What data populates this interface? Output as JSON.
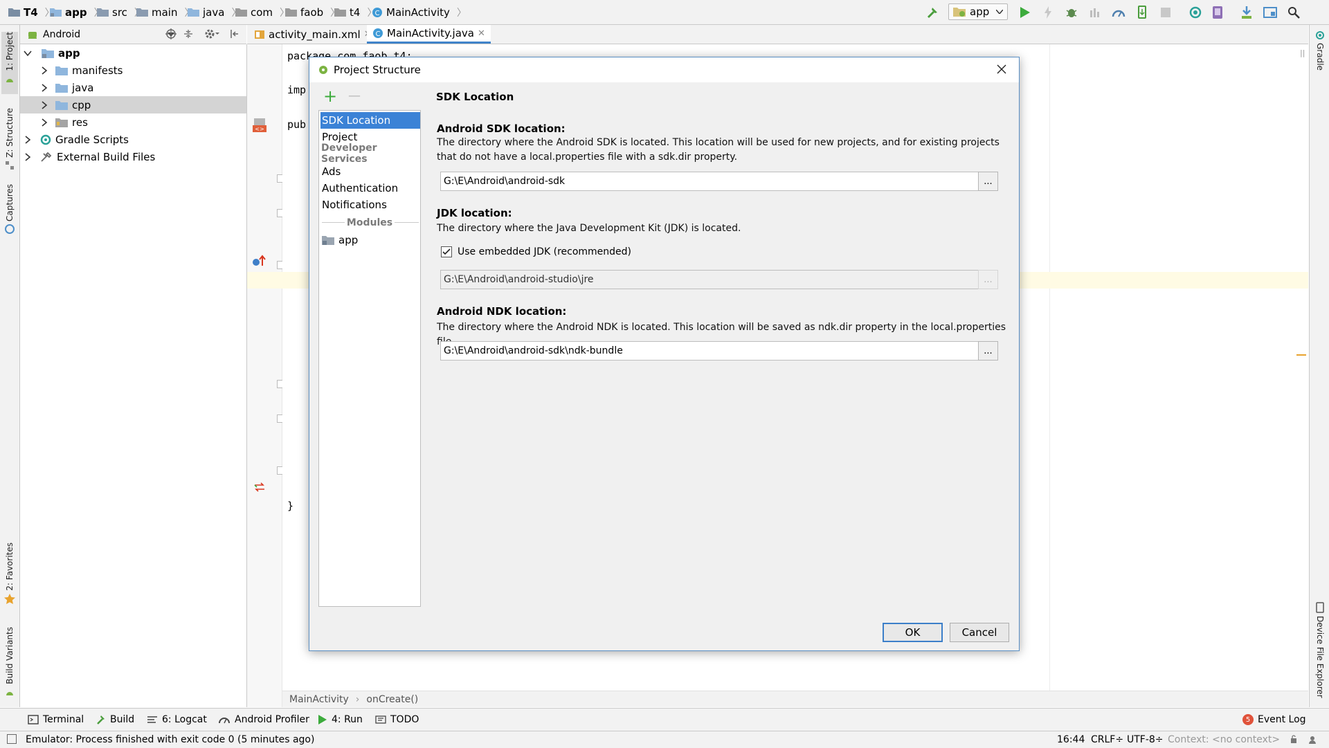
{
  "nav_bar": {
    "breadcrumbs": [
      "T4",
      "app",
      "src",
      "main",
      "java",
      "com",
      "faob",
      "t4",
      "MainActivity"
    ]
  },
  "toolbar": {
    "run_config": "app",
    "icons": [
      "hammer-icon",
      "run-icon",
      "apply-changes-icon",
      "debug-icon",
      "attach-debugger-icon",
      "profile-icon",
      "apply-code-changes-icon",
      "stop-icon",
      "sync-icon",
      "avd-manager-icon",
      "sdk-manager-icon",
      "project-structure-icon",
      "search-icon"
    ]
  },
  "left_tool_tabs": {
    "project": "1: Project",
    "structure": "Z: Structure",
    "captures": "Captures",
    "favorites": "2: Favorites",
    "build_variants": "Build Variants"
  },
  "right_tool_tabs": {
    "gradle": "Gradle",
    "device_file_explorer": "Device File Explorer"
  },
  "project_panel": {
    "view_mode": "Android",
    "tree": [
      {
        "label": "app",
        "level": 0,
        "expanded": true,
        "bold": true
      },
      {
        "label": "manifests",
        "level": 1
      },
      {
        "label": "java",
        "level": 1
      },
      {
        "label": "cpp",
        "level": 1,
        "selected": true
      },
      {
        "label": "res",
        "level": 1
      },
      {
        "label": "Gradle Scripts",
        "level": 0
      },
      {
        "label": "External Build Files",
        "level": 0
      }
    ]
  },
  "editor": {
    "tabs": [
      {
        "label": "activity_main.xml",
        "active": false
      },
      {
        "label": "MainActivity.java",
        "active": true
      }
    ],
    "code_lines": {
      "line1": "package com.faob.t4;",
      "line2": "imp",
      "line3": "pub",
      "line4": "}"
    },
    "breadcrumbs": [
      "MainActivity",
      "onCreate()"
    ]
  },
  "dialog": {
    "title": "Project Structure",
    "add_label": "+",
    "remove_label": "—",
    "nav": {
      "sdk_location": "SDK Location",
      "project": "Project",
      "developer_services_header": "Developer Services",
      "ads": "Ads",
      "authentication": "Authentication",
      "notifications": "Notifications",
      "modules_header": "Modules",
      "app": "app"
    },
    "panel_title": "SDK Location",
    "android_sdk": {
      "heading": "Android SDK location:",
      "description": "The directory where the Android SDK is located. This location will be used for new projects, and for existing projects that do not have a local.properties file with a sdk.dir property.",
      "value": "G:\\E\\Android\\android-sdk",
      "browse": "..."
    },
    "jdk": {
      "heading": "JDK location:",
      "description": "The directory where the Java Development Kit (JDK) is located.",
      "checkbox_label": "Use embedded JDK (recommended)",
      "checkbox_checked": true,
      "value": "G:\\E\\Android\\android-studio\\jre",
      "browse": "..."
    },
    "ndk": {
      "heading": "Android NDK location:",
      "description": "The directory where the Android NDK is located. This location will be saved as ndk.dir property in the local.properties file.",
      "value": "G:\\E\\Android\\android-sdk\\ndk-bundle",
      "browse": "..."
    },
    "ok_label": "OK",
    "cancel_label": "Cancel"
  },
  "bottom_tools": {
    "terminal": "Terminal",
    "build": "Build",
    "logcat": "6: Logcat",
    "profiler": "Android Profiler",
    "run": "4: Run",
    "todo": "TODO",
    "event_log": "Event Log",
    "event_count": "5"
  },
  "status_bar": {
    "message": "Emulator: Process finished with exit code 0 (5 minutes ago)",
    "position": "16:44",
    "line_sep": "CRLF÷",
    "encoding": "UTF-8÷",
    "context": "Context: <no context>"
  },
  "colors": {
    "accent": "#3b82d6",
    "android_green": "#7cb342",
    "run_green": "#3cab3c",
    "folder_blue": "#8fb6dd"
  }
}
